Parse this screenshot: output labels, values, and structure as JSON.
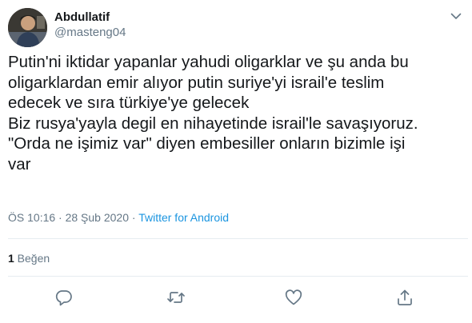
{
  "author": {
    "display_name": "Abdullatif",
    "handle": "@masteng04"
  },
  "tweet": {
    "lines": [
      "Putin'ni iktidar yapanlar yahudi oligarklar ve şu anda bu",
      "oligarklardan emir alıyor putin suriye'yi israil'e teslim",
      "edecek ve sıra türkiye'ye gelecek",
      "Biz rusya'yayla degil en nihayetinde israil'le savaşıyoruz.",
      "\"Orda ne işimiz var\" diyen embesiller onların bizimle işi",
      "var"
    ],
    "timestamp": "ÖS 10:16 · 28 Şub 2020 · ",
    "source": "Twitter for Android"
  },
  "stats": {
    "like_count": "1",
    "like_label": " Beğen"
  },
  "icons": {
    "menu": "chevron-down-icon",
    "reply": "reply-icon",
    "retweet": "retweet-icon",
    "like": "heart-icon",
    "share": "share-icon"
  },
  "colors": {
    "text": "#14171a",
    "secondary": "#657786",
    "link": "#1b95e0",
    "divider": "#e6ecf0"
  }
}
